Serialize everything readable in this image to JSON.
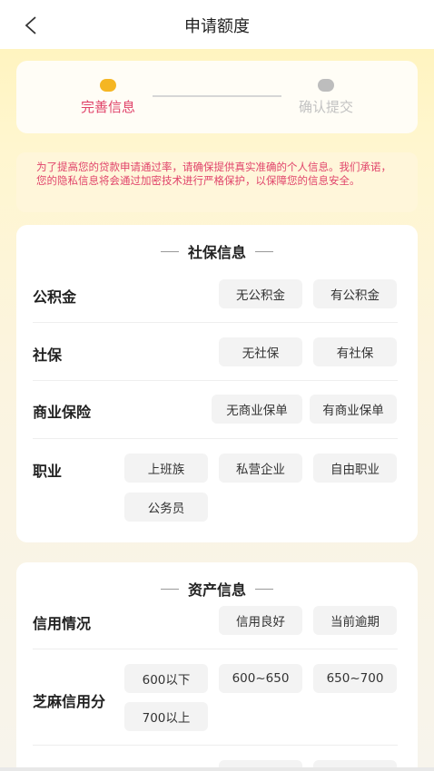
{
  "header": {
    "title": "申请额度",
    "back_icon": "chevron-left-icon"
  },
  "steps": [
    {
      "label": "完善信息",
      "active": true,
      "color": "#e0436a",
      "dot_color": "#f5b623"
    },
    {
      "label": "确认提交",
      "active": false,
      "color": "#c2c2c2",
      "dot_color": "#bdbdbd"
    }
  ],
  "notice": "为了提高您的贷款申请通过率，请确保提供真实准确的个人信息。我们承诺，您的隐私信息将会通过加密技术进行严格保护，以保障您的信息安全。",
  "social_section": {
    "title": "社保信息",
    "rows": [
      {
        "label": "公积金",
        "options": [
          "无公积金",
          "有公积金"
        ]
      },
      {
        "label": "社保",
        "options": [
          "无社保",
          "有社保"
        ]
      },
      {
        "label": "商业保险",
        "options": [
          "无商业保单",
          "有商业保单"
        ]
      },
      {
        "label": "职业",
        "options": [
          "上班族",
          "私营企业",
          "自由职业",
          "公务员"
        ]
      }
    ]
  },
  "asset_section": {
    "title": "资产信息",
    "rows": [
      {
        "label": "信用情况",
        "options": [
          "信用良好",
          "当前逾期"
        ]
      },
      {
        "label": "芝麻信用分",
        "options": [
          "600以下",
          "600~650",
          "650~700",
          "700以上"
        ]
      }
    ]
  },
  "colors": {
    "accent_pink": "#e0436a",
    "accent_yellow": "#f5b623",
    "chip_bg": "#f3f3f3"
  }
}
